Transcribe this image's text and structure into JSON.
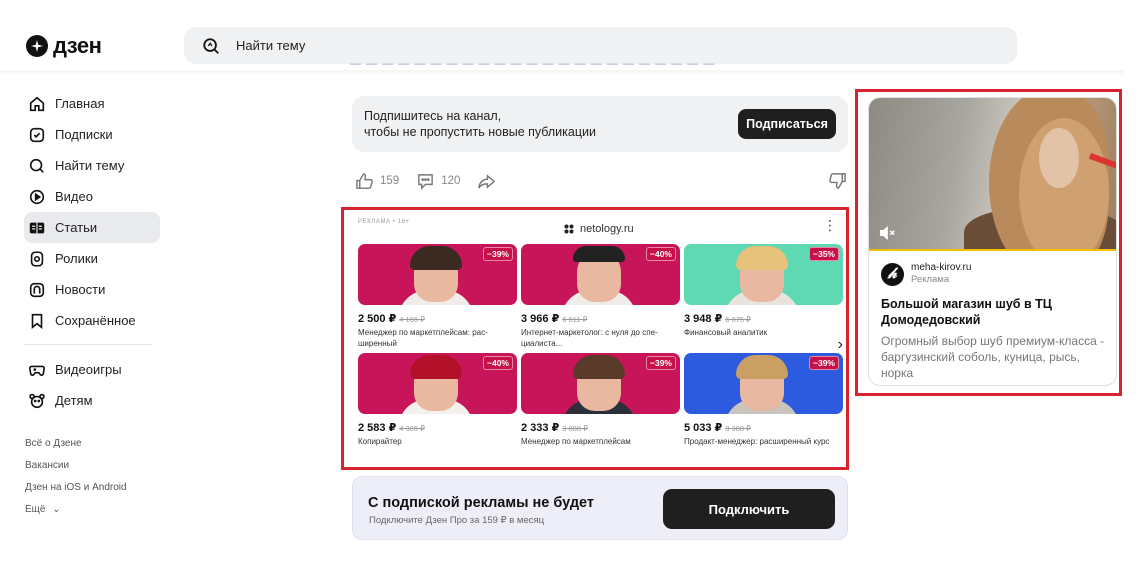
{
  "logo": {
    "text": "дзен"
  },
  "search": {
    "placeholder": "Найти тему"
  },
  "top_fade_text": "— — — — — — — — — — — — — — — — — — — — — — —",
  "sidebar": {
    "items": [
      {
        "label": "Главная",
        "icon": "home-icon"
      },
      {
        "label": "Подписки",
        "icon": "subscriptions-icon"
      },
      {
        "label": "Найти тему",
        "icon": "search-icon"
      },
      {
        "label": "Видео",
        "icon": "video-icon"
      },
      {
        "label": "Статьи",
        "icon": "articles-icon",
        "active": true
      },
      {
        "label": "Ролики",
        "icon": "shorts-icon"
      },
      {
        "label": "Новости",
        "icon": "news-icon"
      },
      {
        "label": "Сохранённое",
        "icon": "bookmark-icon"
      }
    ],
    "items2": [
      {
        "label": "Видеоигры",
        "icon": "gamepad-icon"
      },
      {
        "label": "Детям",
        "icon": "kids-icon"
      }
    ],
    "footer": [
      "Всё о Дзене",
      "Вакансии",
      "Дзен на iOS и Android",
      "Ещё"
    ]
  },
  "subscribe": {
    "line1": "Подпишитесь на канал,",
    "line2": "чтобы не пропустить новые публикации",
    "button": "Подписаться"
  },
  "reactions": {
    "likes": "159",
    "comments": "120"
  },
  "ad": {
    "label": "РЕКЛАМА • 16+",
    "domain": "netology.ru",
    "cards": [
      {
        "discount": "−39%",
        "price": "2 500 ₽",
        "old_price": "4 166 ₽",
        "title": "Менеджер по маркетплейсам: рас-ширенный",
        "bg": "#c8155a"
      },
      {
        "discount": "−40%",
        "price": "3 966 ₽",
        "old_price": "6 611 ₽",
        "title": "Интернет-маркетолог: с нуля до спе-циалиста...",
        "bg": "#c8155a"
      },
      {
        "discount": "−35%",
        "price": "3 948 ₽",
        "old_price": "6 075 ₽",
        "title": "Финансовый аналитик",
        "bg": "#5fd9b3"
      },
      {
        "discount": "−40%",
        "price": "2 583 ₽",
        "old_price": "4 305 ₽",
        "title": "Копирайтер",
        "bg": "#c8155a"
      },
      {
        "discount": "−39%",
        "price": "2 333 ₽",
        "old_price": "3 888 ₽",
        "title": "Менеджер по маркетплейсам",
        "bg": "#c8155a"
      },
      {
        "discount": "−39%",
        "price": "5 033 ₽",
        "old_price": "8 388 ₽",
        "title": "Продакт-менеджер: расширенный курс",
        "bg": "#2d5be0"
      }
    ]
  },
  "pro": {
    "title": "С подпиской рекламы не будет",
    "subtitle": "Подключите Дзен Про за 159 ₽ в месяц",
    "button": "Подключить"
  },
  "side_ad": {
    "source_logo": "𝒽",
    "source": "meha-kirov.ru",
    "tag": "Реклама",
    "title": "Большой магазин шуб в ТЦ Домодедовский",
    "description": "Огромный выбор шуб премиум-класса - баргузинский соболь, куница, рысь, норка"
  }
}
